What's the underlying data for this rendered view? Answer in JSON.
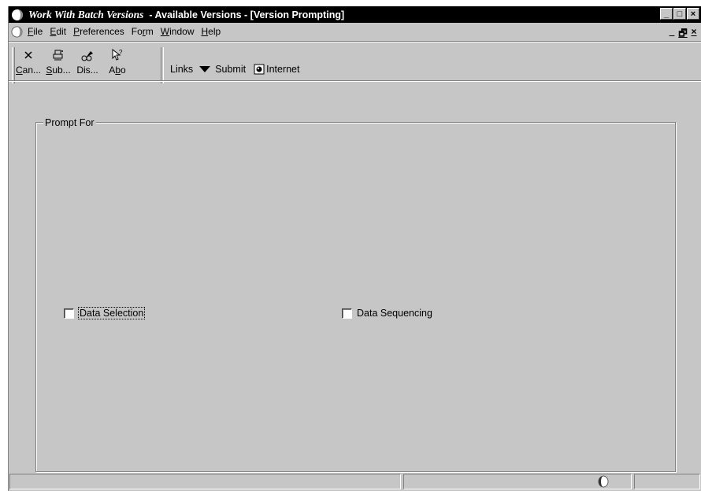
{
  "window": {
    "title_app": "Work With Batch Versions",
    "title_rest": "  - Available Versions - [Version Prompting]",
    "minimize_glyph": "_",
    "maximize_glyph": "□",
    "close_glyph": "×"
  },
  "menu": {
    "items": [
      {
        "pre": "",
        "u": "F",
        "post": "ile"
      },
      {
        "pre": "",
        "u": "E",
        "post": "dit"
      },
      {
        "pre": "",
        "u": "P",
        "post": "references"
      },
      {
        "pre": "Fo",
        "u": "r",
        "post": "m"
      },
      {
        "pre": "",
        "u": "W",
        "post": "indow"
      },
      {
        "pre": "",
        "u": "H",
        "post": "elp"
      }
    ],
    "mdi_minimize": "_",
    "mdi_restore": "🗗",
    "mdi_close": "×"
  },
  "toolbar": {
    "cancel": {
      "u": "C",
      "rest": "an..."
    },
    "submit": {
      "u": "S",
      "rest": "ub..."
    },
    "display": {
      "u": "",
      "rest": "Dis..."
    },
    "about": {
      "pre": "A",
      "u": "b",
      "rest": "o"
    },
    "links_label": "Links",
    "submit_label": "Submit",
    "internet_label": "Internet"
  },
  "form": {
    "group_label": "Prompt For",
    "data_selection": {
      "label": "Data Selection",
      "checked": false
    },
    "data_sequencing": {
      "label": "Data Sequencing",
      "checked": false
    }
  },
  "icons": {
    "app": "jde-globe-icon",
    "cancel": "close-icon",
    "submit": "submit-icon",
    "display": "display-icon",
    "about": "help-pointer-icon",
    "internet": "internet-icon"
  }
}
